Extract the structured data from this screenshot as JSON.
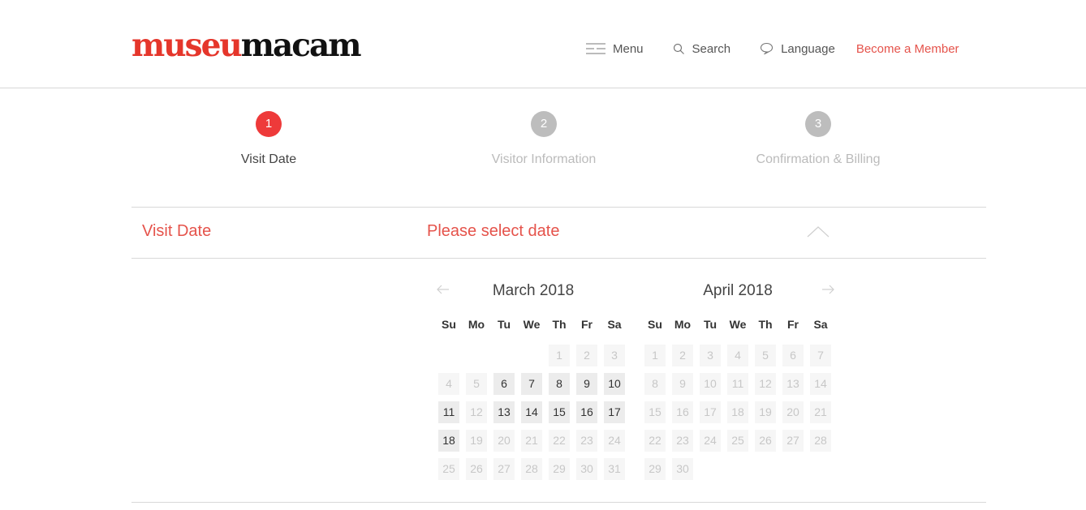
{
  "header": {
    "logo_red": "museu",
    "logo_black": "macam",
    "nav": {
      "menu_label": "Menu",
      "search_label": "Search",
      "language_label": "Language",
      "member_label": "Become a Member"
    }
  },
  "steps": [
    {
      "number": "1",
      "label": "Visit Date",
      "active": true
    },
    {
      "number": "2",
      "label": "Visitor Information",
      "active": false
    },
    {
      "number": "3",
      "label": "Confirmation & Billing",
      "active": false
    }
  ],
  "visit_date": {
    "label": "Visit Date",
    "value": "Please select date"
  },
  "calendar": {
    "weekdays": [
      "Su",
      "Mo",
      "Tu",
      "We",
      "Th",
      "Fr",
      "Sa"
    ],
    "months": [
      {
        "title": "March 2018",
        "leading_blanks": 4,
        "days": 31,
        "available": [
          6,
          7,
          8,
          9,
          10,
          11,
          13,
          14,
          15,
          16,
          17,
          18
        ]
      },
      {
        "title": "April 2018",
        "leading_blanks": 0,
        "days": 30,
        "available": []
      }
    ]
  },
  "colors": {
    "accent": "#e5534b",
    "step_active": "#ee3a3a",
    "step_inactive": "#bdbdbd"
  }
}
